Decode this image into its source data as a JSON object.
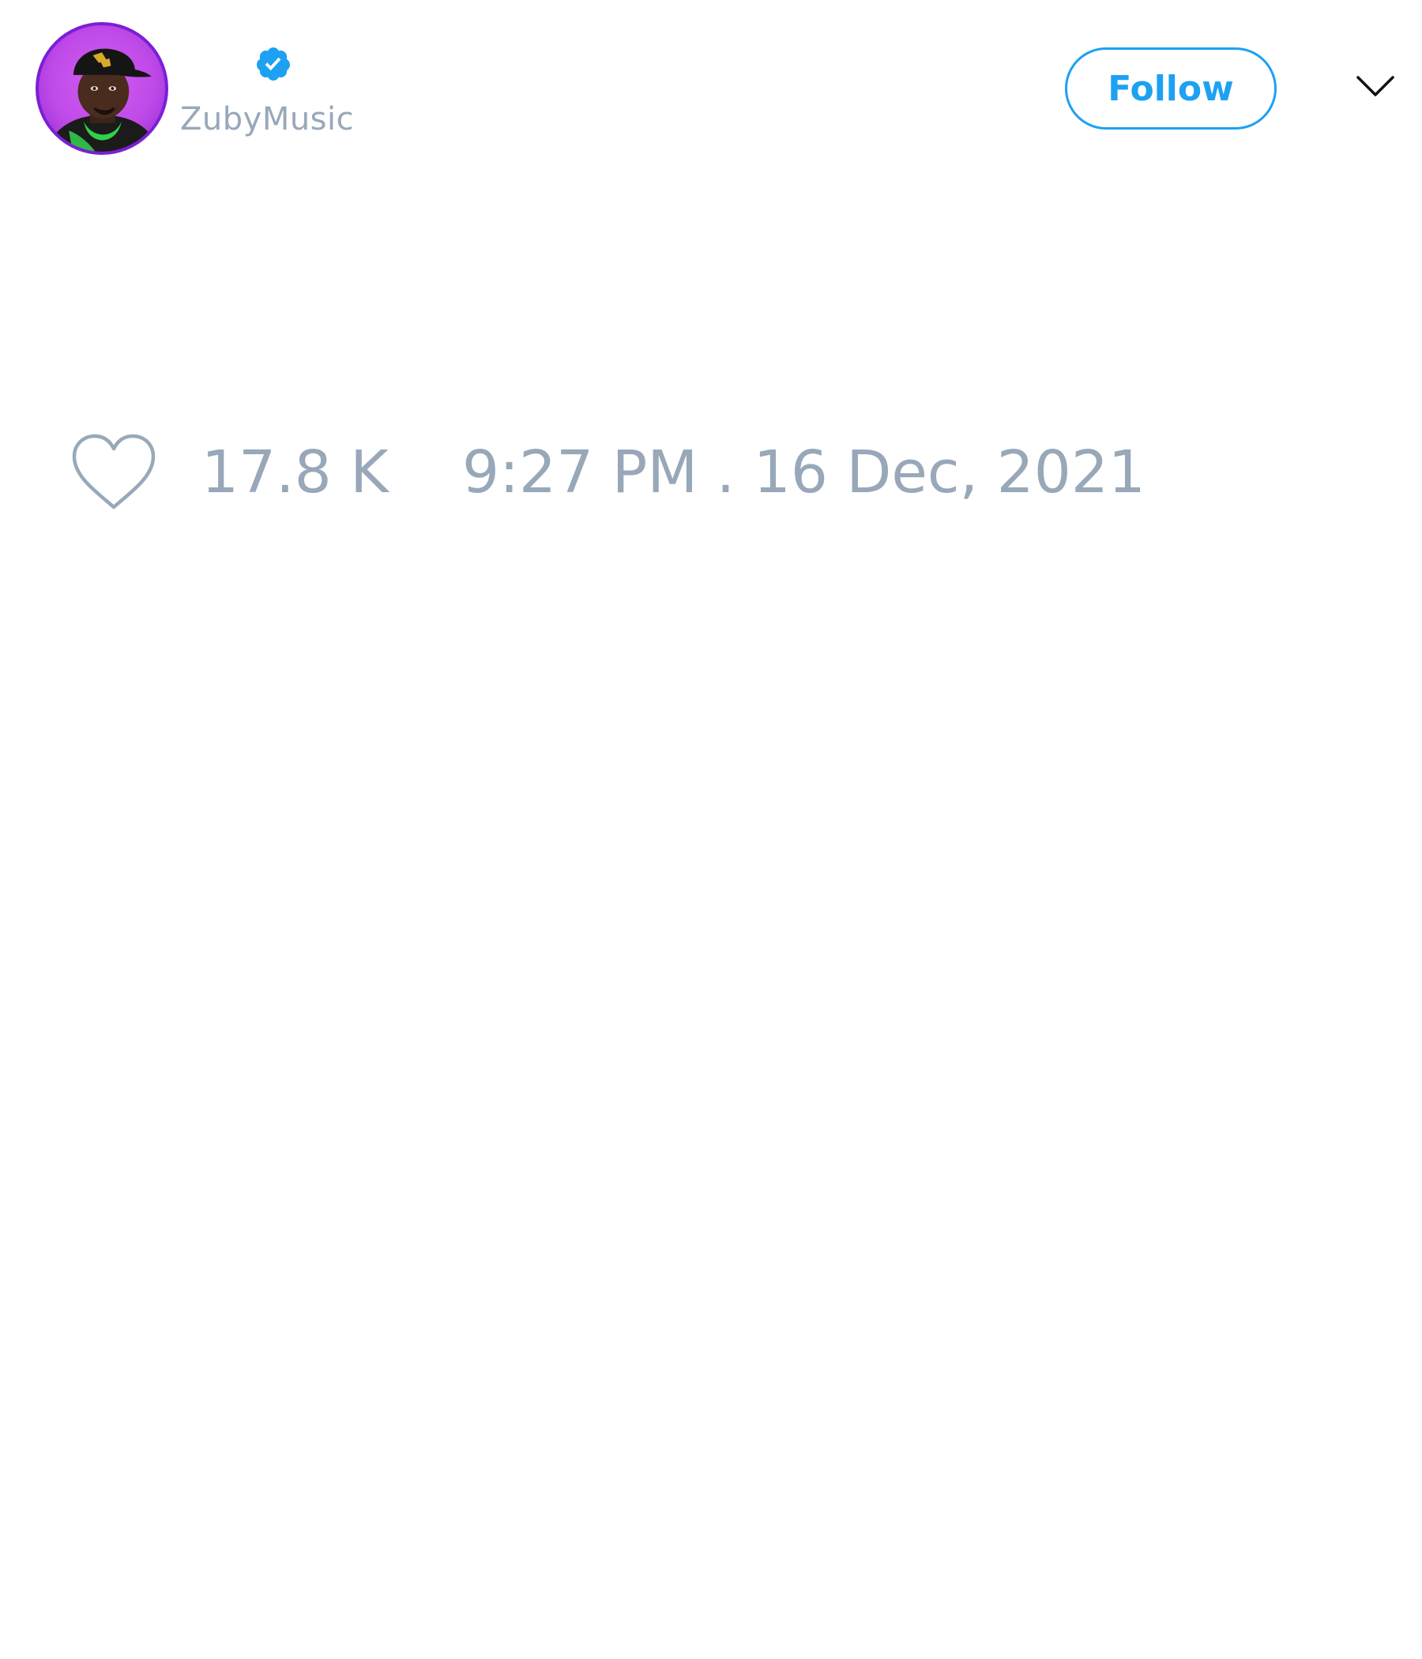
{
  "tweet": {
    "author": {
      "handle": "ZubyMusic",
      "verified": true,
      "avatar": "profile-photo"
    },
    "follow_label": "Follow",
    "menu_icon": "chevron-down-icon",
    "likes": {
      "icon": "heart-icon",
      "count": "17.8 K"
    },
    "timestamp": "9:27 PM . 16 Dec, 2021"
  },
  "colors": {
    "accent": "#1da1f2",
    "muted_text": "#98a8b9",
    "avatar_background": "#c04ae8"
  }
}
